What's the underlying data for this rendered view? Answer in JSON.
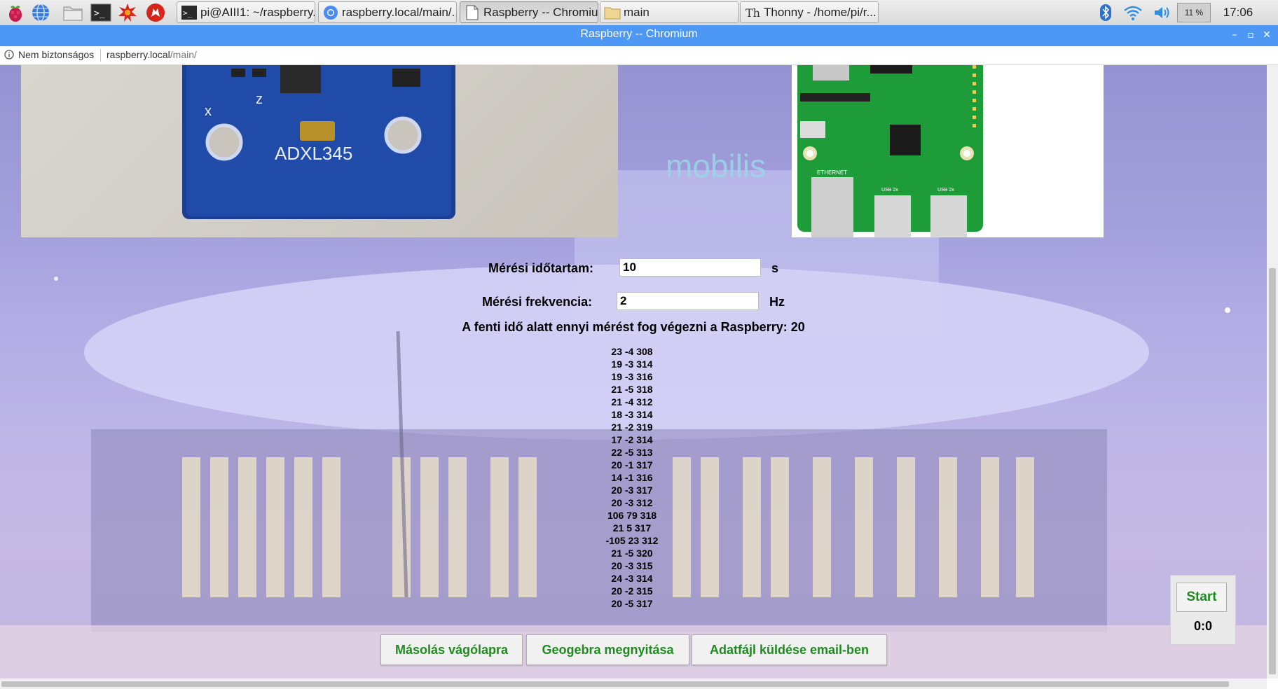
{
  "taskbar": {
    "launchers": [
      {
        "icon": "raspberry-menu-icon"
      },
      {
        "icon": "web-browser-icon"
      },
      {
        "icon": "file-manager-icon"
      },
      {
        "icon": "terminal-icon"
      },
      {
        "icon": "math-kernel-icon"
      },
      {
        "icon": "wolfram-icon"
      }
    ],
    "tasks": [
      {
        "icon": "terminal-icon",
        "label": "pi@AIII1: ~/raspberry..."
      },
      {
        "icon": "chromium-icon",
        "label": "raspberry.local/main/..."
      },
      {
        "icon": "document-icon",
        "label": "Raspberry -- Chromiu..."
      },
      {
        "icon": "folder-icon",
        "label": "main"
      },
      {
        "icon": "thonny-icon",
        "label": "Thonny  -  /home/pi/r..."
      }
    ],
    "cpu": "11 %",
    "clock": "17:06"
  },
  "window": {
    "title": "Raspberry -- Chromium"
  },
  "address": {
    "security": "Nem biztonságos",
    "host": "raspberry.local",
    "path": "/main/"
  },
  "form": {
    "duration_label": "Mérési időtartam:",
    "duration_value": "10",
    "duration_unit": "s",
    "frequency_label": "Mérési frekvencia:",
    "frequency_value": "2",
    "frequency_unit": "Hz",
    "count_text": "A fenti idő alatt ennyi mérést fog végezni a Raspberry: 20"
  },
  "images": {
    "sensor_label": "ADXL345",
    "board_ethernet": "ETHERNET",
    "board_usb": "USB 2x",
    "background_sign": "mobilis"
  },
  "readings": [
    "23 -4 308",
    "19 -3 314",
    "19 -3 316",
    "21 -5 318",
    "21 -4 312",
    "18 -3 314",
    "21 -2 319",
    "17 -2 314",
    "22 -5 313",
    "20 -1 317",
    "14 -1 316",
    "20 -3 317",
    "20 -3 312",
    "106 79 318",
    "21 5 317",
    "-105 23 312",
    "21 -5 320",
    "20 -3 315",
    "24 -3 314",
    "20 -2 315",
    "20 -5 317"
  ],
  "actions": {
    "copy": "Másolás vágólapra",
    "geogebra": "Geogebra megnyitása",
    "email": "Adatfájl küldése email-ben"
  },
  "start": {
    "label": "Start",
    "timer": "0:0"
  },
  "colors": {
    "titlebar": "#4d98f5",
    "button_text": "#1f8a1f"
  }
}
